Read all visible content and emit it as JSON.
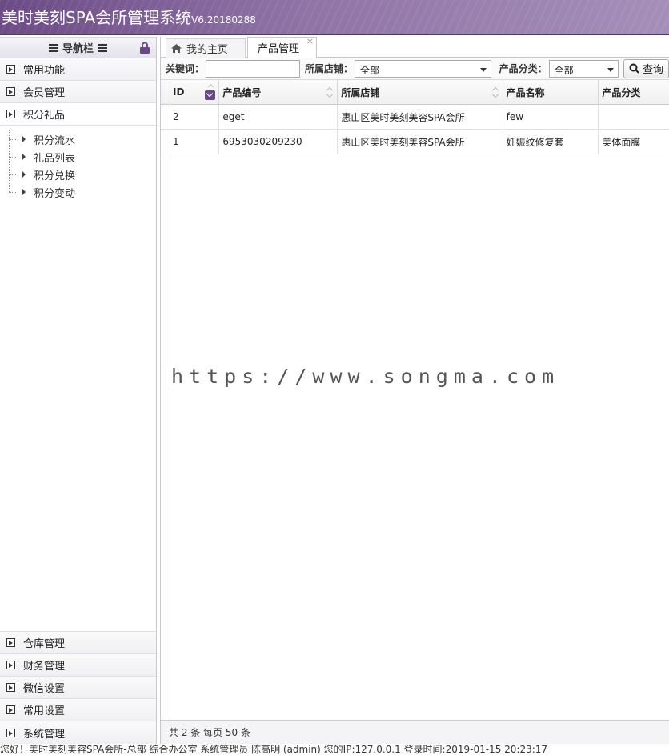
{
  "header": {
    "title": "美时美刻SPA会所管理系统",
    "version": "V6.20180288"
  },
  "sidebar": {
    "nav_title": "导航栏",
    "top_groups": [
      {
        "label": "常用功能"
      },
      {
        "label": "会员管理"
      },
      {
        "label": "积分礼品"
      }
    ],
    "sub_items": [
      {
        "label": "积分流水"
      },
      {
        "label": "礼品列表"
      },
      {
        "label": "积分兑换"
      },
      {
        "label": "积分变动"
      }
    ],
    "bottom_groups": [
      {
        "label": "仓库管理"
      },
      {
        "label": "财务管理"
      },
      {
        "label": "微信设置"
      },
      {
        "label": "常用设置"
      },
      {
        "label": "系统管理"
      }
    ]
  },
  "tabs": {
    "home": "我的主页",
    "current": "产品管理",
    "close": "×"
  },
  "toolbar": {
    "keyword_label": "关键词：",
    "keyword_value": "",
    "store_label": "所属店铺：",
    "store_value": "全部",
    "category_label": "产品分类：",
    "category_value": "全部",
    "search_label": "查询"
  },
  "grid": {
    "columns": [
      "ID",
      "产品编号",
      "所属店铺",
      "产品名称",
      "产品分类"
    ],
    "rows": [
      {
        "id": "2",
        "code": "eget",
        "store": "惠山区美时美刻美容SPA会所",
        "name": "few",
        "category": ""
      },
      {
        "id": "1",
        "code": "6953030209230",
        "store": "惠山区美时美刻美容SPA会所",
        "name": "妊娠纹修复套",
        "category": "美体面膜"
      }
    ],
    "footer": "共 2 条 每页 50 条"
  },
  "watermark": "https://www.songma.com",
  "statusbar": "您好！美时美刻美容SPA会所-总部 综合办公室 系统管理员 陈高明 (admin) 您的IP:127.0.0.1 登录时间:2019-01-15 20:23:17",
  "colors": {
    "accent": "#6a4a86",
    "header_start": "#6c4b86",
    "header_end": "#a58fb8"
  }
}
